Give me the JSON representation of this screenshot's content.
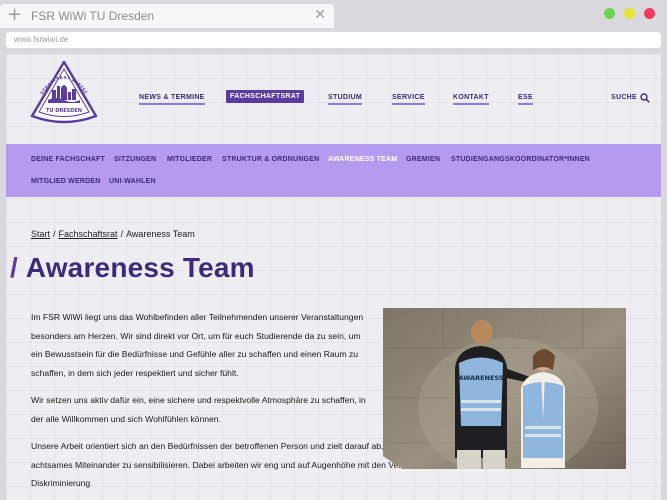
{
  "browser": {
    "tab_title": "FSR WiWi TU Dresden",
    "url": "www.fsrwiwi.de",
    "dot_colors": [
      "#6cd44f",
      "#e8e230",
      "#ef3a5d"
    ]
  },
  "logo": {
    "top_text": "FACHSCHAFTSRAT WIRTSCHAFT",
    "bottom_text": "TU DRESDEN",
    "accent": "#5b3d9f"
  },
  "main_nav": {
    "items": [
      {
        "label": "NEWS & TERMINE",
        "active": false
      },
      {
        "label": "FACHSCHAFTSRAT",
        "active": true
      },
      {
        "label": "STUDIUM",
        "active": false
      },
      {
        "label": "SERVICE",
        "active": false
      },
      {
        "label": "KONTAKT",
        "active": false
      },
      {
        "label": "ESE",
        "active": false
      }
    ],
    "search_label": "SUCHE",
    "search_icon": "search-icon"
  },
  "sub_nav": {
    "items": [
      {
        "label": "DEINE FACHSCHAFT",
        "active": false
      },
      {
        "label": "SITZUNGEN",
        "active": false
      },
      {
        "label": "MITGLIEDER",
        "active": false
      },
      {
        "label": "STRUKTUR & ORDNUNGEN",
        "active": false
      },
      {
        "label": "AWARENESS TEAM",
        "active": true
      },
      {
        "label": "GREMIEN",
        "active": false
      },
      {
        "label": "STUDIENGANGSKOORDINATOR*INNEN",
        "active": false
      },
      {
        "label": "MITGLIED WERDEN",
        "active": false
      },
      {
        "label": "UNI-WAHLEN",
        "active": false
      }
    ]
  },
  "breadcrumb": {
    "items": [
      "Start",
      "Fachschaftsrat"
    ],
    "current": "Awareness Team",
    "separator": "/"
  },
  "page": {
    "title_prefix": "/",
    "title": "Awareness Team",
    "paragraphs": [
      "Im FSR WiWi liegt uns das Wohlbefinden aller Teilnehmenden unserer Veranstaltungen besonders am Herzen. Wir sind direkt vor Ort, um für euch Studierende da zu sein, um ein Bewusstsein für die Bedürfnisse und Gefühle aller zu schaffen und einen Raum zu schaffen, in dem sich jeder respektiert und sicher fühlt.",
      "Wir setzen uns aktiv dafür ein, eine sichere und respektvolle Atmosphäre zu schaffen, in der alle Willkommen und sich Wohlfühlen können.",
      "Unsere Arbeit orientiert sich an den Bedürfnissen der betroffenen Person und zielt darauf ab, Selbstbestimmung zu stärken und für ein achtsames Miteinander zu sensibilisieren. Dabei arbeiten wir eng und auf Augenhöhe mit den Veranstaltenden und Gästen zusammen, um Diskriminierung"
    ],
    "photo_vest_text": "AWARENESS"
  }
}
